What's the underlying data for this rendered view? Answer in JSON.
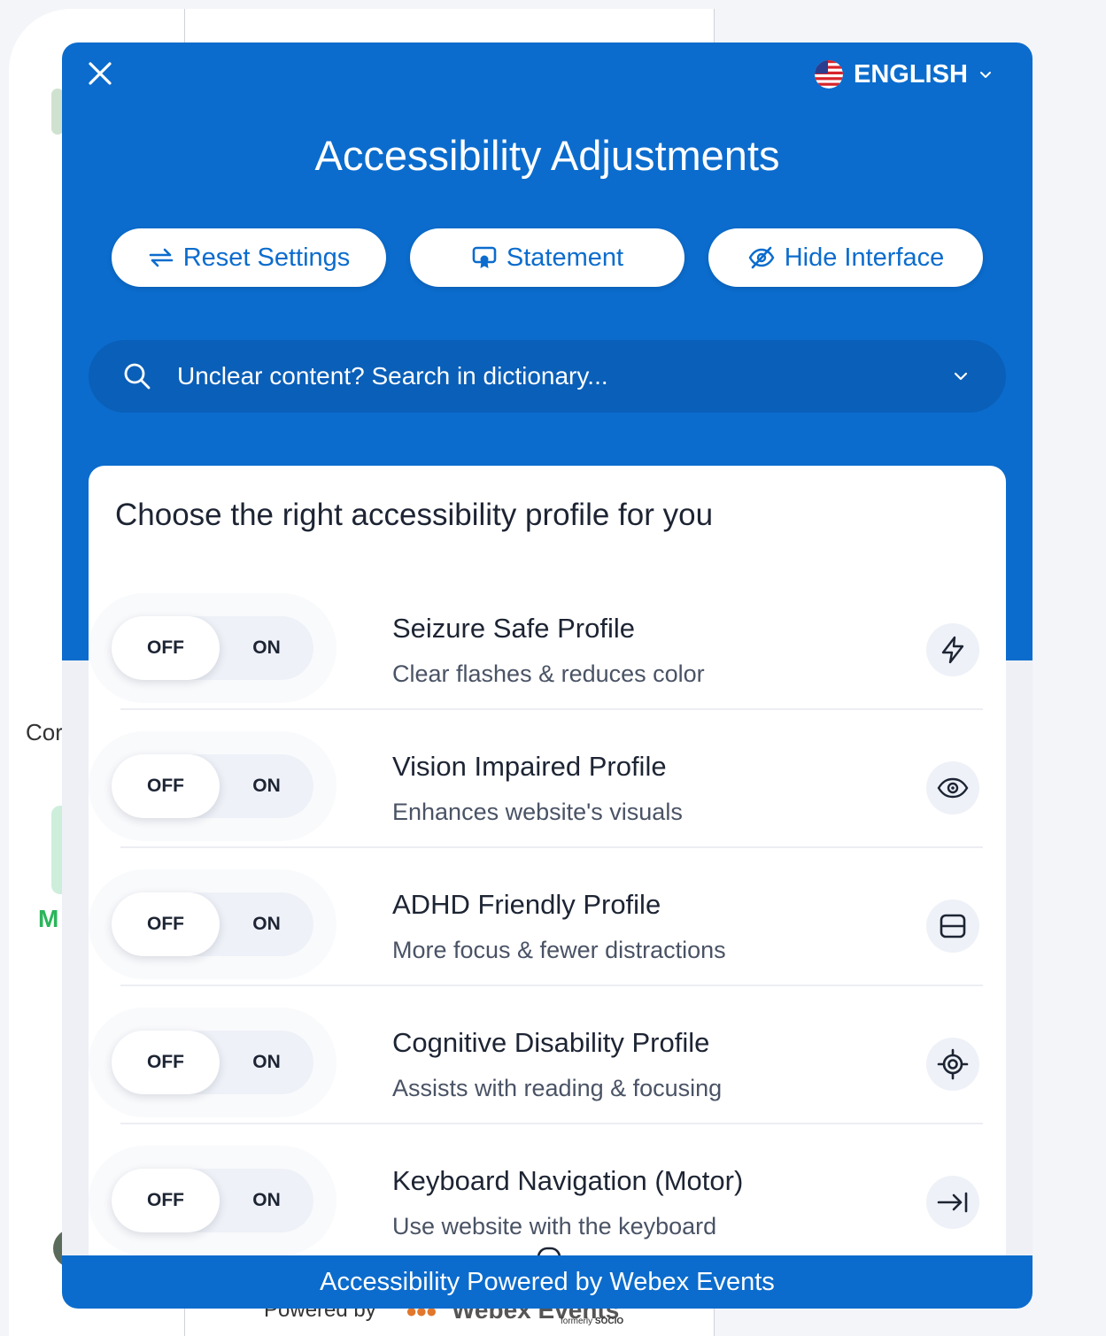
{
  "background": {
    "left_text": "Cor",
    "green_text": "M",
    "powered_text": "Powered by",
    "webex_word": "Webex Events",
    "formerly_text": "formerly",
    "formerly_brand": "SOCIO"
  },
  "header": {
    "language": "ENGLISH",
    "language_icon": "us-flag-icon",
    "title": "Accessibility Adjustments"
  },
  "actions": {
    "reset_label": "Reset Settings",
    "statement_label": "Statement",
    "hide_label": "Hide Interface"
  },
  "search": {
    "placeholder": "Unclear content? Search in dictionary..."
  },
  "profiles": {
    "heading": "Choose the right accessibility profile for you",
    "items": [
      {
        "title": "Seizure Safe Profile",
        "subtitle": "Clear flashes & reduces color",
        "off": "OFF",
        "on": "ON",
        "state": "off",
        "icon": "lightning-icon"
      },
      {
        "title": "Vision Impaired Profile",
        "subtitle": "Enhances website's visuals",
        "off": "OFF",
        "on": "ON",
        "state": "off",
        "icon": "eye-icon"
      },
      {
        "title": "ADHD Friendly Profile",
        "subtitle": "More focus & fewer distractions",
        "off": "OFF",
        "on": "ON",
        "state": "off",
        "icon": "focus-frame-icon"
      },
      {
        "title": "Cognitive Disability Profile",
        "subtitle": "Assists with reading & focusing",
        "off": "OFF",
        "on": "ON",
        "state": "off",
        "icon": "target-icon"
      },
      {
        "title": "Keyboard Navigation (Motor)",
        "subtitle": "Use website with the keyboard",
        "off": "OFF",
        "on": "ON",
        "state": "off",
        "icon": "arrow-to-bar-icon"
      }
    ]
  },
  "footer": {
    "label": "Accessibility Powered by Webex Events"
  },
  "colors": {
    "brand_blue": "#0b6ccd",
    "search_blue": "#0a5fb8"
  }
}
